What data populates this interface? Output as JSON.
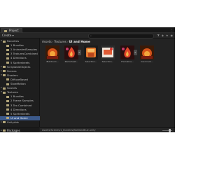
{
  "panel": {
    "tab_label": "Project",
    "menu_glyph": "⋮"
  },
  "toolbar": {
    "create_label": "Create ▾",
    "search_icon": "search-icon",
    "search_placeholder": "",
    "icons": [
      "filter-icon",
      "tag-icon",
      "star-icon",
      "eye-icon"
    ]
  },
  "tree": {
    "items": [
      {
        "label": "Favorites",
        "level": 0,
        "expanded": true
      },
      {
        "label": "1 Bundles",
        "level": 1
      },
      {
        "label": "2 AnimatedSamples",
        "level": 1
      },
      {
        "label": "3 TexturesCombined",
        "level": 1
      },
      {
        "label": "4 Directions",
        "level": 1
      },
      {
        "label": "5 Spritesheets",
        "level": 1
      },
      {
        "label": "ScriptableObjects",
        "level": 0
      },
      {
        "label": "Scenes",
        "level": 0
      },
      {
        "label": "Shaders",
        "level": 0,
        "expanded": true
      },
      {
        "label": "DiffuseBased",
        "level": 1
      },
      {
        "label": "SlowMotion",
        "level": 1
      },
      {
        "label": "Sounds",
        "level": 0
      },
      {
        "label": "Textures",
        "level": 0,
        "expanded": true
      },
      {
        "label": "1 Bundles",
        "level": 1
      },
      {
        "label": "2 Frame Samples",
        "level": 1
      },
      {
        "label": "3 Tex Combined",
        "level": 1
      },
      {
        "label": "4 Directions",
        "level": 1
      },
      {
        "label": "5 Spritesheets",
        "level": 1
      },
      {
        "label": "UI and Home",
        "level": 1,
        "selected": true
      },
      {
        "label": "UnityAds",
        "level": 0
      }
    ],
    "packages_label": "Packages"
  },
  "breadcrumb": {
    "parts": [
      "Assets",
      "Textures",
      "UI and Home"
    ]
  },
  "assets": [
    {
      "label": "Buildnum...",
      "kind": "fire"
    },
    {
      "label": "Ranksheet...",
      "kind": "flame"
    },
    {
      "label": "Selection...",
      "kind": "orange"
    },
    {
      "label": "Selection...",
      "kind": "card"
    },
    {
      "label": "Frameline...",
      "kind": "flame"
    },
    {
      "label": "Crackrock...",
      "kind": "fire"
    }
  ],
  "status": {
    "path": "Assets/Scenes/1_Bundles/BallisticBlue.unity"
  },
  "colors": {
    "panel_bg": "#1f1f1f",
    "selection": "#3c5a8b",
    "folder": "#b2a57a"
  }
}
